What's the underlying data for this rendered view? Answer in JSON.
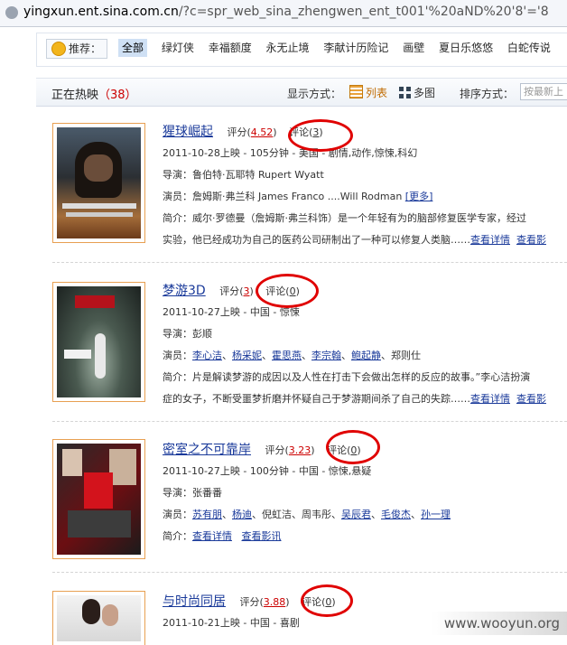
{
  "address_bar": {
    "host": "yingxun.ent.sina.com.cn",
    "rest": "/?c=spr_web_sina_zhengwen_ent_t001'%20aND%20'8'='8"
  },
  "recommend": {
    "label": "推荐：",
    "items": [
      "全部",
      "绿灯侠",
      "幸福额度",
      "永无止境",
      "李献计历险记",
      "画壁",
      "夏日乐悠悠",
      "白蛇传说"
    ]
  },
  "header": {
    "title": "正在热映",
    "count": "（38）",
    "mode_label": "显示方式：",
    "list_label": "列表",
    "grid_label": "多图",
    "sort_label": "排序方式：",
    "sort_placeholder": "按最新上"
  },
  "movies": [
    {
      "title": "猩球崛起",
      "score_label": "评分",
      "score": "4.52",
      "comment_label": "评论",
      "comments": "3",
      "release": "2011-10-28上映 - 105分钟 - 美国 - 剧情,动作,惊悚,科幻",
      "director": "导演：鲁伯特·瓦耶特 Rupert Wyatt",
      "actors_prefix": "演员：詹姆斯·弗兰科 James Franco ....Will Rodman ",
      "actors_more": "[更多]",
      "synopsis1": "简介：威尔·罗德曼（詹姆斯·弗兰科饰）是一个年轻有为的脑部修复医学专家，经过",
      "synopsis2": "实验，他已经成功为自己的医药公司研制出了一种可以修复人类脑……",
      "detail_link": "查看详情",
      "news_link": "查看影"
    },
    {
      "title": "梦游3D",
      "score_label": "评分",
      "score": "3",
      "comment_label": "评论",
      "comments": "0",
      "release": "2011-10-27上映 - 中国 - 惊悚",
      "director": "导演：彭顺",
      "actors_label": "演员：",
      "actors": [
        "李心洁",
        "杨采妮",
        "霍思燕",
        "李宗翰",
        "鲍起静",
        "郑则仕"
      ],
      "synopsis1": "简介：片是解读梦游的成因以及人性在打击下会做出怎样的反应的故事。”李心洁扮演",
      "synopsis2": "症的女子，不断受噩梦折磨并怀疑自己于梦游期间杀了自己的失踪……",
      "detail_link": "查看详情",
      "news_link": "查看影"
    },
    {
      "title": "密室之不可靠岸",
      "score_label": "评分",
      "score": "3.23",
      "comment_label": "评论",
      "comments": "0",
      "release": "2011-10-27上映 - 100分钟 - 中国 - 惊悚,悬疑",
      "director": "导演：张番番",
      "actors_label": "演员：",
      "actors": [
        "苏有朋",
        "杨迪",
        "倪虹洁",
        "周韦彤",
        "吴辰君",
        "毛俊杰",
        "孙一理"
      ],
      "synopsis_label": "简介：",
      "detail_link": "查看详情",
      "news_link": "查看影讯"
    },
    {
      "title": "与时尚同居",
      "score_label": "评分",
      "score": "3.88",
      "comment_label": "评论",
      "comments": "0",
      "release": "2011-10-21上映 - 中国 - 喜剧"
    }
  ],
  "watermark": "www.wooyun.org",
  "colors": {
    "link": "#1a3a9a",
    "score": "#cc0000",
    "annotation": "#e00000",
    "poster_border": "#e8a052"
  }
}
